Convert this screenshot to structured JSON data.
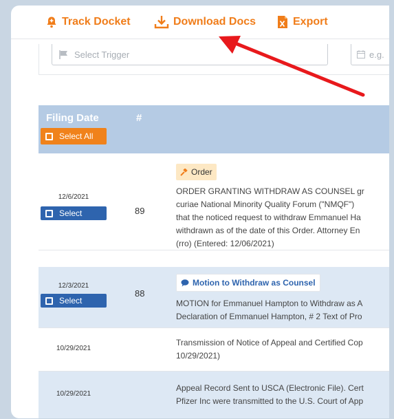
{
  "toolbar": {
    "track_docket": "Track Docket",
    "download_docs": "Download Docs",
    "export": "Export"
  },
  "filters": {
    "trigger_placeholder": "Select Trigger",
    "date_placeholder": "e.g."
  },
  "table": {
    "header_filing_date": "Filing Date",
    "header_number": "#",
    "select_all": "Select All",
    "select_label": "Select",
    "rows": [
      {
        "date": "12/6/2021",
        "number": "89",
        "badge": "Order",
        "lines": [
          "ORDER GRANTING WITHDRAW AS COUNSEL gr",
          "curiae National Minority Quality Forum (\"NMQF\")",
          "that the noticed request to withdraw Emmanuel Ha",
          "withdrawn as of the date of this Order. Attorney En",
          "(rro) (Entered: 12/06/2021)"
        ]
      },
      {
        "date": "12/3/2021",
        "number": "88",
        "badge": "Motion to Withdraw as Counsel",
        "lines": [
          "MOTION for Emmanuel Hampton to Withdraw as A",
          "Declaration of Emmanuel Hampton, # 2 Text of Pro"
        ]
      },
      {
        "date": "10/29/2021",
        "number": "",
        "badge": "",
        "lines": [
          "Transmission of Notice of Appeal and Certified Cop",
          "10/29/2021)"
        ]
      },
      {
        "date": "10/29/2021",
        "number": "",
        "badge": "",
        "lines": [
          "Appeal Record Sent to USCA (Electronic File). Cert",
          "Pfizer Inc were transmitted to the U.S. Court of App"
        ]
      }
    ]
  },
  "colors": {
    "accent_orange": "#f07d1a",
    "header_blue": "#b5cbe4",
    "select_blue": "#2e64ae",
    "row_shade": "#dde8f4",
    "arrow_red": "#e8191c"
  },
  "icons": [
    "bell-plus-icon",
    "download-icon",
    "excel-icon",
    "flag-icon",
    "calendar-icon",
    "checkbox-icon",
    "gavel-icon",
    "speech-bubble-icon"
  ]
}
